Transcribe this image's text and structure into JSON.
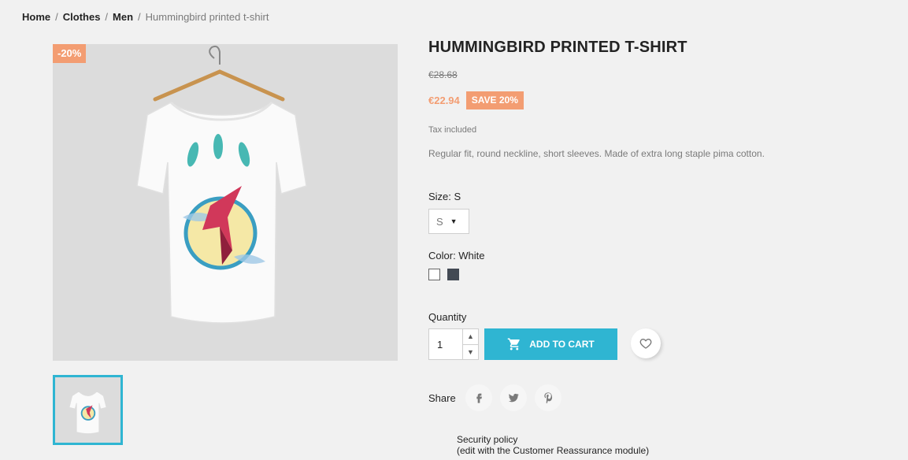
{
  "breadcrumb": {
    "items": [
      "Home",
      "Clothes",
      "Men"
    ],
    "separator": "/",
    "current": "Hummingbird printed t-shirt"
  },
  "product": {
    "discount_flag": "-20%",
    "title": "HUMMINGBIRD PRINTED T-SHIRT",
    "old_price": "€28.68",
    "current_price": "€22.94",
    "save_badge": "SAVE 20%",
    "tax_note": "Tax included",
    "description": "Regular fit, round neckline, short sleeves. Made of extra long staple pima cotton."
  },
  "variants": {
    "size_label": "Size: S",
    "size_selected": "S",
    "color_label": "Color: White",
    "colors": [
      "#ffffff",
      "#434a54"
    ]
  },
  "cart": {
    "quantity_label": "Quantity",
    "quantity_value": "1",
    "add_to_cart_label": "ADD TO CART"
  },
  "share": {
    "label": "Share"
  },
  "reassurance": {
    "line1": "Security policy",
    "line2": "(edit with the Customer Reassurance module)"
  },
  "colors": {
    "accent": "#2fb5d2",
    "discount": "#f39d72"
  },
  "icons": [
    "cart-icon",
    "heart-icon",
    "facebook-icon",
    "twitter-icon",
    "pinterest-icon",
    "caret-down-icon",
    "arrow-up-icon",
    "arrow-down-icon"
  ]
}
